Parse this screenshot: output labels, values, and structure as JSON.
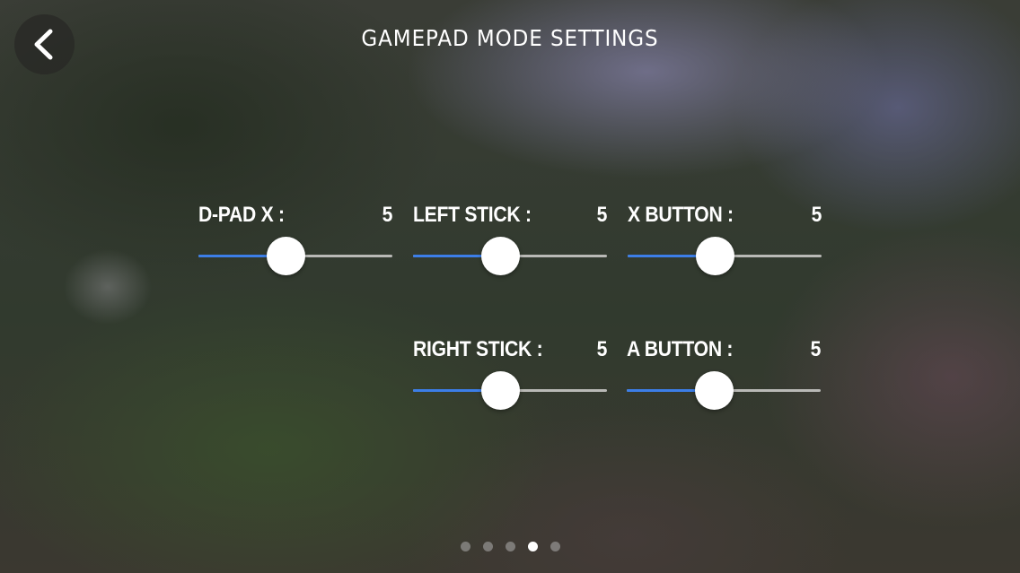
{
  "header": {
    "title": "GAMEPAD MODE SETTINGS",
    "back_icon": "chevron-left-icon"
  },
  "settings": [
    {
      "label": "D-PAD X :",
      "value": "5",
      "level": 0.45
    },
    {
      "label": "LEFT STICK :",
      "value": "5",
      "level": 0.45
    },
    {
      "label": "X BUTTON :",
      "value": "5",
      "level": 0.45
    },
    {
      "label": "RIGHT STICK :",
      "value": "5",
      "level": 0.45
    },
    {
      "label": "A BUTTON :",
      "value": "5",
      "level": 0.45
    }
  ],
  "pager": {
    "count": 5,
    "active_index": 3
  },
  "colors": {
    "slider_fill": "#3c7ee8",
    "slider_track": "#b9b9b6",
    "thumb": "#ffffff",
    "dot_active": "#ffffff",
    "dot_inactive": "#afafaf"
  }
}
